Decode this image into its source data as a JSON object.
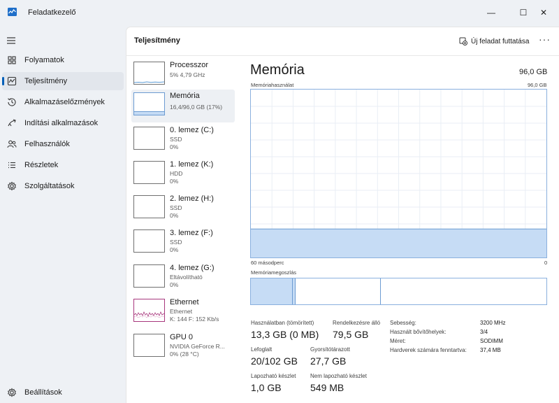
{
  "window": {
    "title": "Feladatkezelő",
    "minimize_glyph": "—",
    "maximize_glyph": "☐",
    "close_glyph": "✕"
  },
  "sidebar": {
    "items": [
      {
        "label": "Folyamatok",
        "icon": "processes-icon"
      },
      {
        "label": "Teljesítmény",
        "icon": "performance-icon",
        "active": true
      },
      {
        "label": "Alkalmazáselőzmények",
        "icon": "history-icon"
      },
      {
        "label": "Indítási alkalmazások",
        "icon": "startup-icon"
      },
      {
        "label": "Felhasználók",
        "icon": "users-icon"
      },
      {
        "label": "Részletek",
        "icon": "details-icon"
      },
      {
        "label": "Szolgáltatások",
        "icon": "services-icon"
      }
    ],
    "settings_label": "Beállítások"
  },
  "header": {
    "title": "Teljesítmény",
    "run_task_label": "Új feladat futtatása",
    "more_label": "···"
  },
  "devices": [
    {
      "name": "Processzor",
      "sub1": "5%  4,79 GHz",
      "sub2": ""
    },
    {
      "name": "Memória",
      "sub1": "16,4/96,0 GB (17%)",
      "sub2": ""
    },
    {
      "name": "0. lemez (C:)",
      "sub1": "SSD",
      "sub2": "0%"
    },
    {
      "name": "1. lemez (K:)",
      "sub1": "HDD",
      "sub2": "0%"
    },
    {
      "name": "2. lemez (H:)",
      "sub1": "SSD",
      "sub2": "0%"
    },
    {
      "name": "3. lemez (F:)",
      "sub1": "SSD",
      "sub2": "0%"
    },
    {
      "name": "4. lemez (G:)",
      "sub1": "Eltávolítható",
      "sub2": "0%"
    },
    {
      "name": "Ethernet",
      "sub1": "Ethernet",
      "sub2": "K: 144  F: 152 Kb/s"
    },
    {
      "name": "GPU 0",
      "sub1": "NVIDIA GeForce R...",
      "sub2": "0% (28 °C)"
    }
  ],
  "detail": {
    "title": "Memória",
    "total": "96,0 GB",
    "usage_graph_label": "Memóriahasználat",
    "usage_graph_max": "96,0 GB",
    "usage_fraction": 0.17,
    "time_left_label": "60 másodperc",
    "time_right_label": "0",
    "composition_label": "Memóriamegoszlás",
    "composition": {
      "in_use_gb": 13.3,
      "modified_gb": 1.0,
      "standby_gb": 27.7,
      "free_gb": 1.0,
      "total_gb": 96.0
    },
    "stats": {
      "in_use_label": "Használatban (tömörített)",
      "in_use_value": "13,3 GB (0 MB)",
      "available_label": "Rendelkezésre álló",
      "available_value": "79,5 GB",
      "committed_label": "Lefoglalt",
      "committed_value": "20/102 GB",
      "cached_label": "Gyorsítótárazott",
      "cached_value": "27,7 GB",
      "paged_label": "Lapozható készlet",
      "paged_value": "1,0 GB",
      "nonpaged_label": "Nem lapozható készlet",
      "nonpaged_value": "549 MB"
    },
    "specs": [
      {
        "label": "Sebesség:",
        "value": "3200 MHz"
      },
      {
        "label": "Használt bővítőhelyek:",
        "value": "3/4"
      },
      {
        "label": "Méret:",
        "value": "SODIMM"
      },
      {
        "label": "Hardverek számára fenntartva:",
        "value": "37,4 MB"
      }
    ]
  },
  "colors": {
    "accent": "#005fb8",
    "memory_fill": "#c6dcf5",
    "memory_line": "#6c9bd2",
    "cpu_line": "#5d9cd6",
    "ethernet_line": "#a8377d",
    "grid": "#e9eef5"
  }
}
